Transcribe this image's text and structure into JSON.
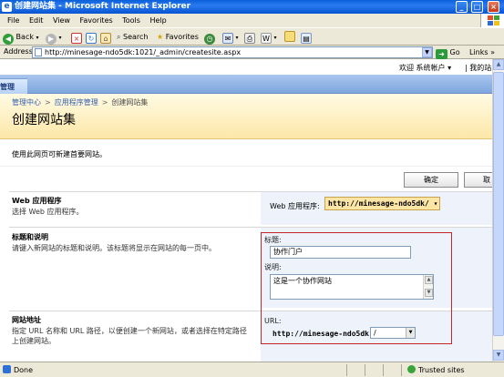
{
  "window": {
    "title": "创建网站集 - Microsoft Internet Explorer"
  },
  "menu": [
    "File",
    "Edit",
    "View",
    "Favorites",
    "Tools",
    "Help"
  ],
  "toolbar": {
    "back": "Back",
    "search": "Search",
    "favorites": "Favorites"
  },
  "address": {
    "label": "Address",
    "url": "http://minesage-ndo5dk:1021/_admin/createsite.aspx",
    "go": "Go",
    "links": "Links"
  },
  "page": {
    "welcome": "欢迎 系统帐户 ▾",
    "mysite": "我的站",
    "topbar_tab": "管理",
    "breadcrumb": [
      "管理中心",
      "应用程序管理",
      "创建网站集"
    ],
    "breadcrumb_sep": ">",
    "title": "创建网站集",
    "description": "使用此网页可新建首要网站。",
    "ok": "确定",
    "cancel": "取",
    "sections": {
      "webapp": {
        "title": "Web 应用程序",
        "desc": "选择 Web 应用程序。",
        "label": "Web 应用程序:",
        "value": "http://minesage-ndo5dk/ ▾"
      },
      "titledesc": {
        "title": "标题和说明",
        "desc": "请键入新网站的标题和说明。该标题将显示在网站的每一页中。",
        "title_label": "标题:",
        "title_value": "协作门户",
        "desc_label": "说明:",
        "desc_value": "这是一个协作网站"
      },
      "url": {
        "title": "网站地址",
        "desc": "指定 URL 名称和 URL 路径，以便创建一个新网站，或者选择在特定路径上创建网站。",
        "label": "URL:",
        "prefix": "http://minesage-ndo5dk",
        "path": "/"
      }
    }
  },
  "status": {
    "text": "Done",
    "zone": "Trusted sites"
  }
}
